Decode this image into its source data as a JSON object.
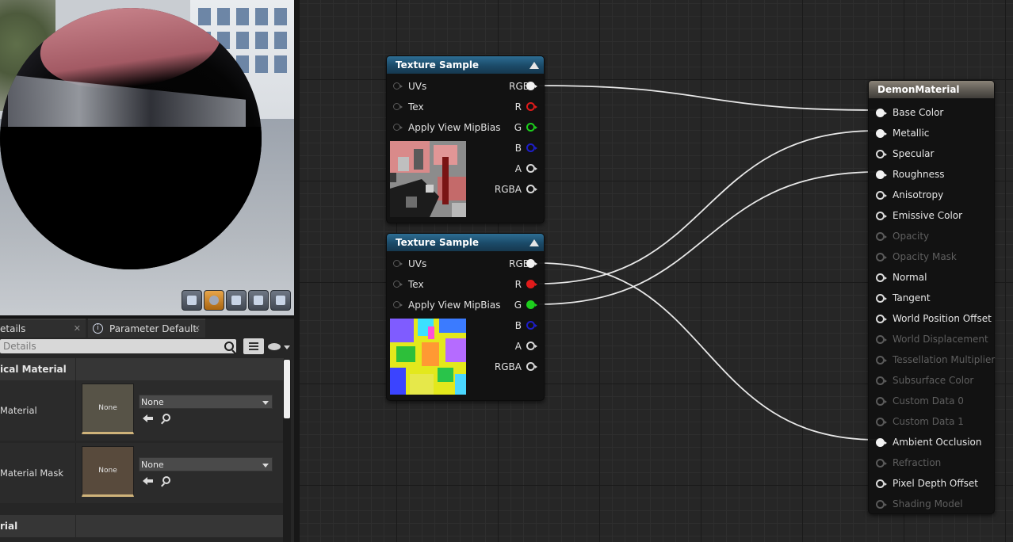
{
  "colors": {
    "pin_white": "#f2f2f2",
    "pin_red": "#e01b1b",
    "pin_green": "#1dce1d",
    "pin_blue": "#1e1ec8",
    "pin_disabled": "#5a5a5a",
    "wire": "#e8e8e8",
    "header_texture": "#1f5577",
    "header_material": "#6b665d"
  },
  "details_panel": {
    "tabs": [
      {
        "label": "etails",
        "icon": "close-icon"
      },
      {
        "label": "Parameter Defaults",
        "icon": "info-icon"
      }
    ],
    "search_placeholder": "Details",
    "sections": [
      {
        "title": "ical Material"
      },
      {
        "title": "rial"
      }
    ],
    "properties": [
      {
        "label": "Material",
        "thumbnail": "None",
        "value": "None"
      },
      {
        "label": "Material Mask",
        "thumbnail": "None",
        "value": "None"
      }
    ]
  },
  "viewport": {
    "toolbar_icons": [
      "cylinder-icon",
      "sphere-icon",
      "plane-icon",
      "cube-icon",
      "teapot-icon"
    ],
    "active_icon": "sphere-icon"
  },
  "graph": {
    "texture_nodes": [
      {
        "title": "Texture Sample",
        "inputs": [
          "UVs",
          "Tex",
          "Apply View MipBias"
        ],
        "outputs": [
          {
            "label": "RGB",
            "color": "#f2f2f2",
            "connected": true
          },
          {
            "label": "R",
            "color": "#e01b1b",
            "connected": false
          },
          {
            "label": "G",
            "color": "#1dce1d",
            "connected": false
          },
          {
            "label": "B",
            "color": "#1e1ec8",
            "connected": false
          },
          {
            "label": "A",
            "color": "#d8d8d8",
            "connected": false
          },
          {
            "label": "RGBA",
            "color": "#d8d8d8",
            "connected": false
          }
        ]
      },
      {
        "title": "Texture Sample",
        "inputs": [
          "UVs",
          "Tex",
          "Apply View MipBias"
        ],
        "outputs": [
          {
            "label": "RGB",
            "color": "#f2f2f2",
            "connected": true
          },
          {
            "label": "R",
            "color": "#e01b1b",
            "connected": true
          },
          {
            "label": "G",
            "color": "#1dce1d",
            "connected": true
          },
          {
            "label": "B",
            "color": "#1e1ec8",
            "connected": false
          },
          {
            "label": "A",
            "color": "#d8d8d8",
            "connected": false
          },
          {
            "label": "RGBA",
            "color": "#d8d8d8",
            "connected": false
          }
        ]
      }
    ],
    "material_node": {
      "title": "DemonMaterial",
      "inputs": [
        {
          "label": "Base Color",
          "enabled": true,
          "connected": true
        },
        {
          "label": "Metallic",
          "enabled": true,
          "connected": true
        },
        {
          "label": "Specular",
          "enabled": true,
          "connected": false
        },
        {
          "label": "Roughness",
          "enabled": true,
          "connected": true
        },
        {
          "label": "Anisotropy",
          "enabled": true,
          "connected": false
        },
        {
          "label": "Emissive Color",
          "enabled": true,
          "connected": false
        },
        {
          "label": "Opacity",
          "enabled": false,
          "connected": false
        },
        {
          "label": "Opacity Mask",
          "enabled": false,
          "connected": false
        },
        {
          "label": "Normal",
          "enabled": true,
          "connected": false
        },
        {
          "label": "Tangent",
          "enabled": true,
          "connected": false
        },
        {
          "label": "World Position Offset",
          "enabled": true,
          "connected": false
        },
        {
          "label": "World Displacement",
          "enabled": false,
          "connected": false
        },
        {
          "label": "Tessellation Multiplier",
          "enabled": false,
          "connected": false
        },
        {
          "label": "Subsurface Color",
          "enabled": false,
          "connected": false
        },
        {
          "label": "Custom Data 0",
          "enabled": false,
          "connected": false
        },
        {
          "label": "Custom Data 1",
          "enabled": false,
          "connected": false
        },
        {
          "label": "Ambient Occlusion",
          "enabled": true,
          "connected": true
        },
        {
          "label": "Refraction",
          "enabled": false,
          "connected": false
        },
        {
          "label": "Pixel Depth Offset",
          "enabled": true,
          "connected": false
        },
        {
          "label": "Shading Model",
          "enabled": false,
          "connected": false
        }
      ]
    }
  }
}
